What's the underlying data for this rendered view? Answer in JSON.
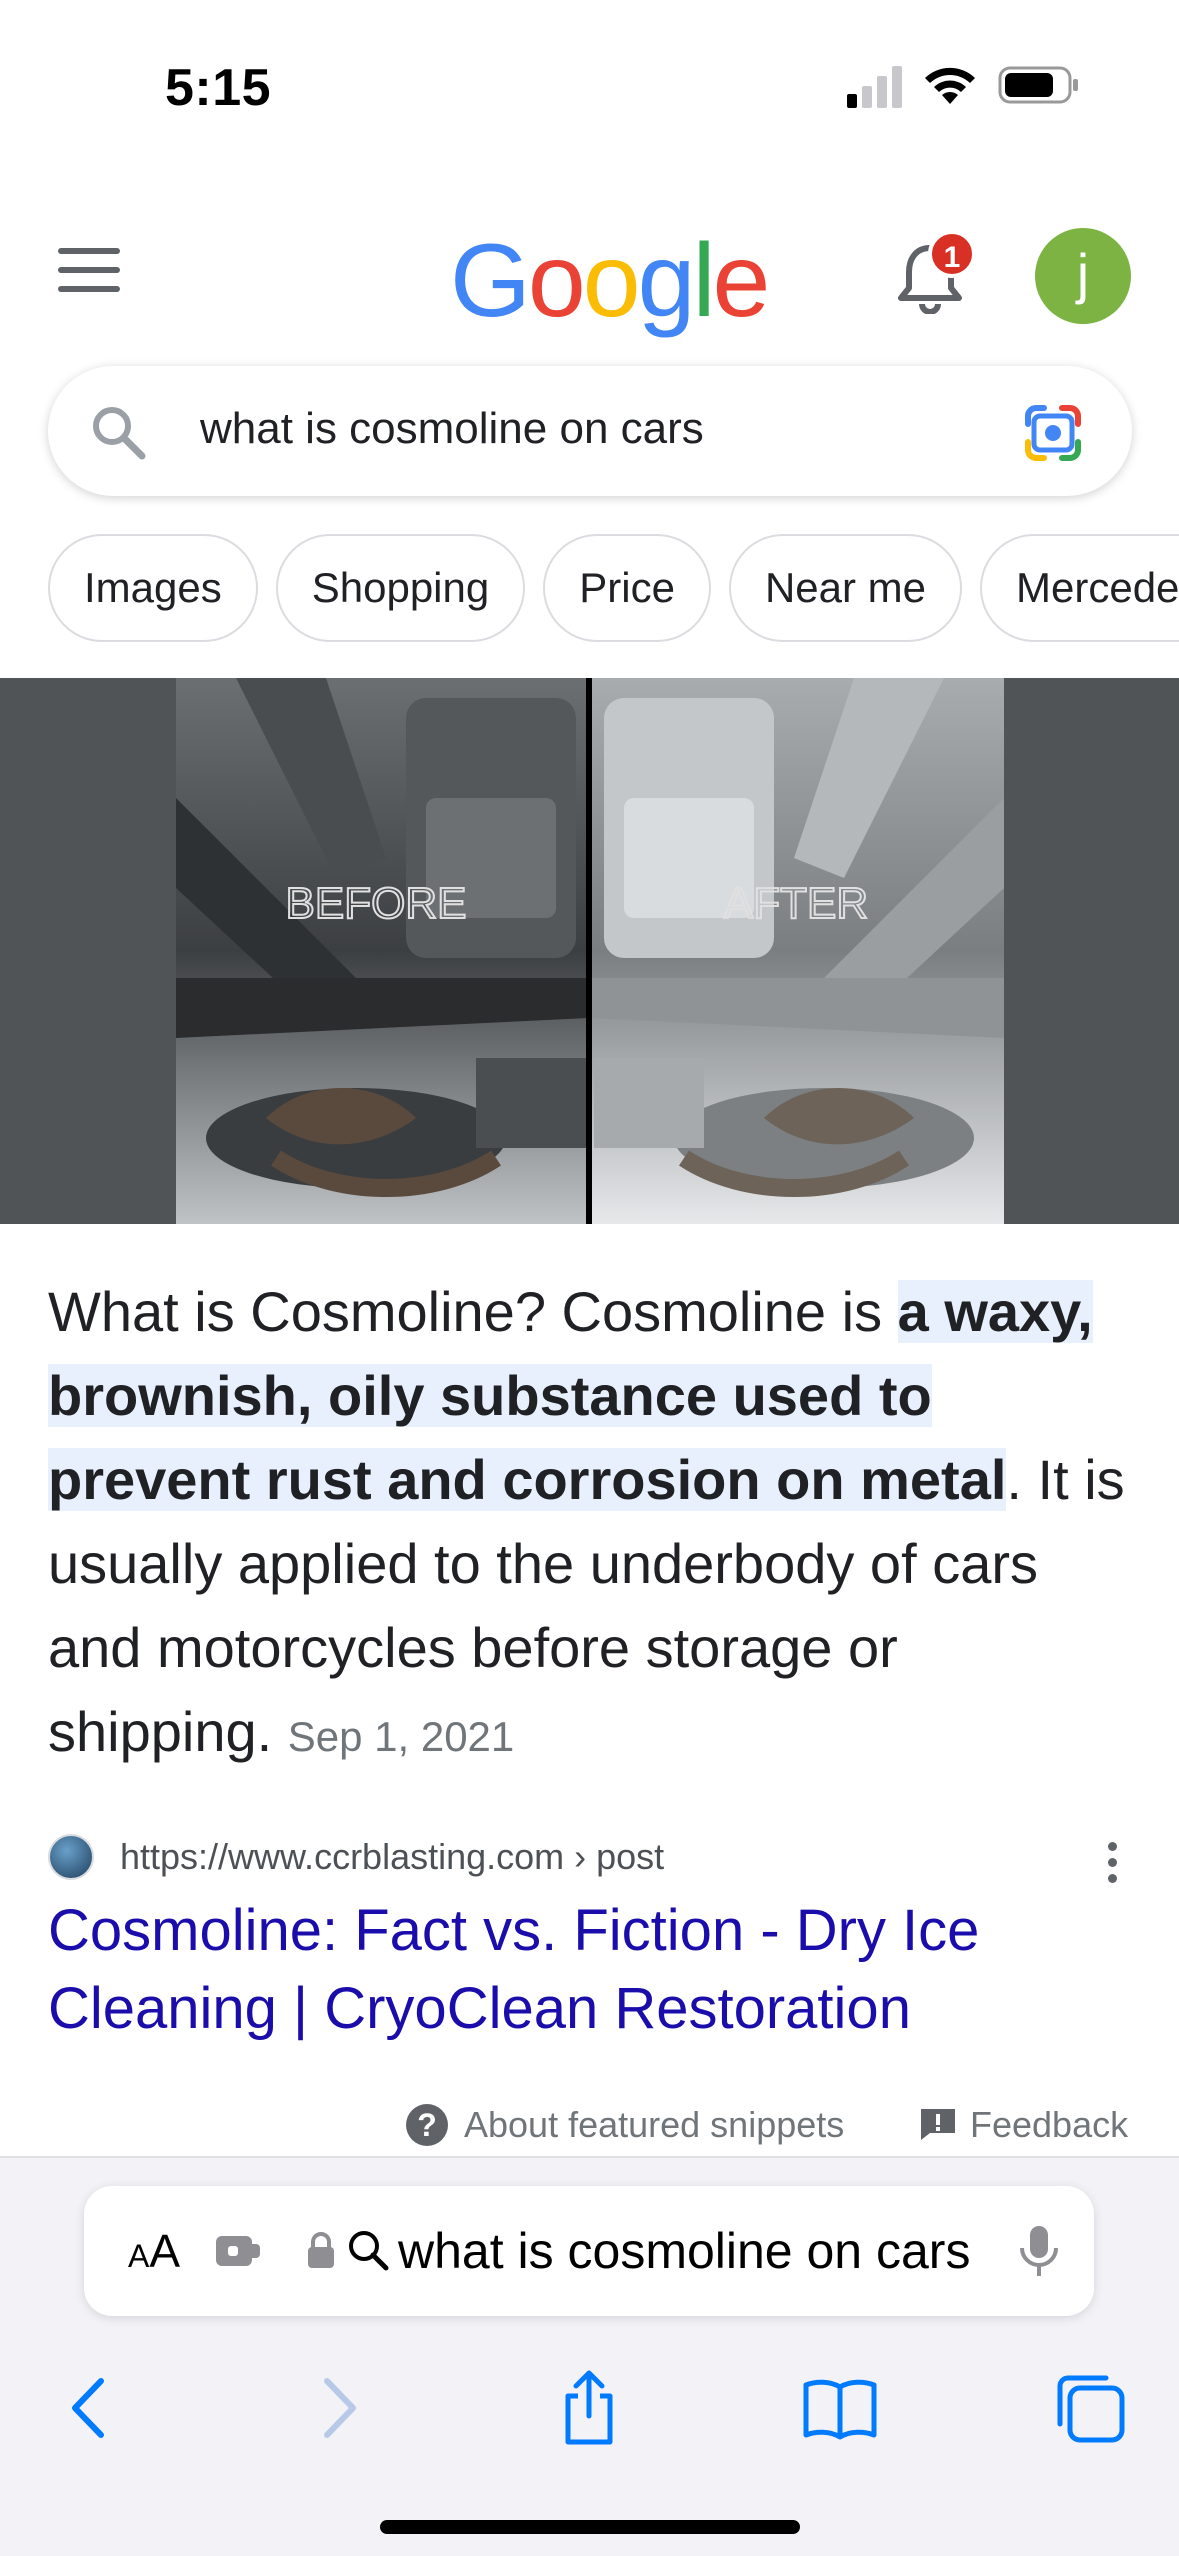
{
  "status_bar": {
    "time": "5:15"
  },
  "header": {
    "logo": [
      {
        "ch": "G",
        "color": "#4285F4"
      },
      {
        "ch": "o",
        "color": "#EA4335"
      },
      {
        "ch": "o",
        "color": "#FBBC05"
      },
      {
        "ch": "g",
        "color": "#4285F4"
      },
      {
        "ch": "l",
        "color": "#34A853"
      },
      {
        "ch": "e",
        "color": "#EA4335"
      }
    ],
    "notification_count": "1",
    "avatar_letter": "j",
    "avatar_color": "#7cb342"
  },
  "search": {
    "query": "what is cosmoline on cars"
  },
  "chips": [
    "Images",
    "Shopping",
    "Price",
    "Near me",
    "Mercedes"
  ],
  "featured_image": {
    "before_label": "BEFORE",
    "after_label": "AFTER"
  },
  "snippet": {
    "lead": "What is Cosmoline? Cosmoline is ",
    "highlight": "a waxy, brownish, oily substance used to prevent rust and corrosion on metal",
    "rest": ". It is usually applied to the underbody of cars and motorcycles before storage or shipping.",
    "date": "Sep 1, 2021"
  },
  "source": {
    "url": "https://www.ccrblasting.com › post",
    "title": "Cosmoline: Fact vs. Fiction - Dry Ice Cleaning | CryoClean Restoration"
  },
  "footer_links": {
    "about": "About featured snippets",
    "feedback": "Feedback"
  },
  "safari": {
    "aa_label_small": "A",
    "aa_label_large": "A",
    "address": "what is cosmoline on cars"
  },
  "colors": {
    "link": "#1a0dab",
    "highlight": "#e8f0fe",
    "accent_blue": "#007aff"
  }
}
